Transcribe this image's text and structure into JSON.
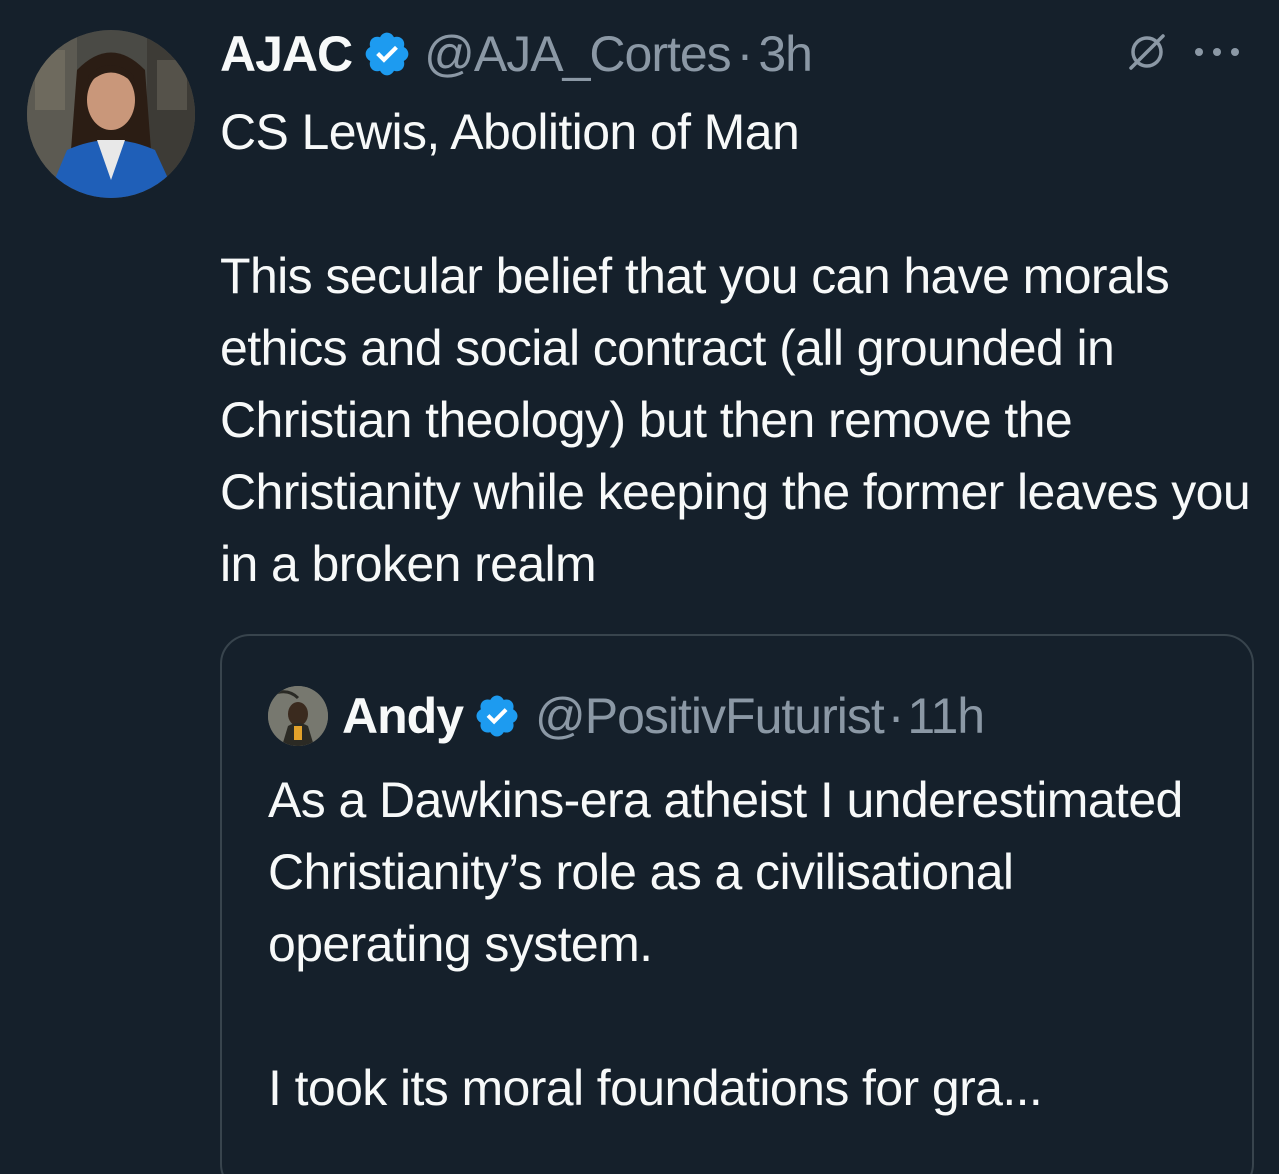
{
  "tweet": {
    "author_name": "AJAC",
    "handle": "@AJA_Cortes",
    "separator": "·",
    "time": "3h",
    "text_line1": "CS Lewis, Abolition of Man",
    "text_line2": "This secular belief that you can have morals ethics and social contract (all grounded in Christian theology) but then remove the Christianity while keeping the former leaves you in a broken realm",
    "avatar_icon": "profile-photo",
    "verified_icon": "verified-badge-icon",
    "action_icons": [
      "grok-icon",
      "more-icon"
    ]
  },
  "quote": {
    "author_name": "Andy",
    "handle": "@PositivFuturist",
    "separator": "·",
    "time": "11h",
    "text_line1": "As a Dawkins-era atheist I underestimated Christianity’s role as a civilisational operating system.",
    "text_line2": "I took its moral foundations for gra...",
    "avatar_icon": "profile-photo",
    "verified_icon": "verified-badge-icon"
  },
  "colors": {
    "background": "#15202b",
    "text_primary": "#f7f9f9",
    "text_secondary": "#8b98a5",
    "verified_blue": "#1d9bf0",
    "border": "#38444d"
  }
}
